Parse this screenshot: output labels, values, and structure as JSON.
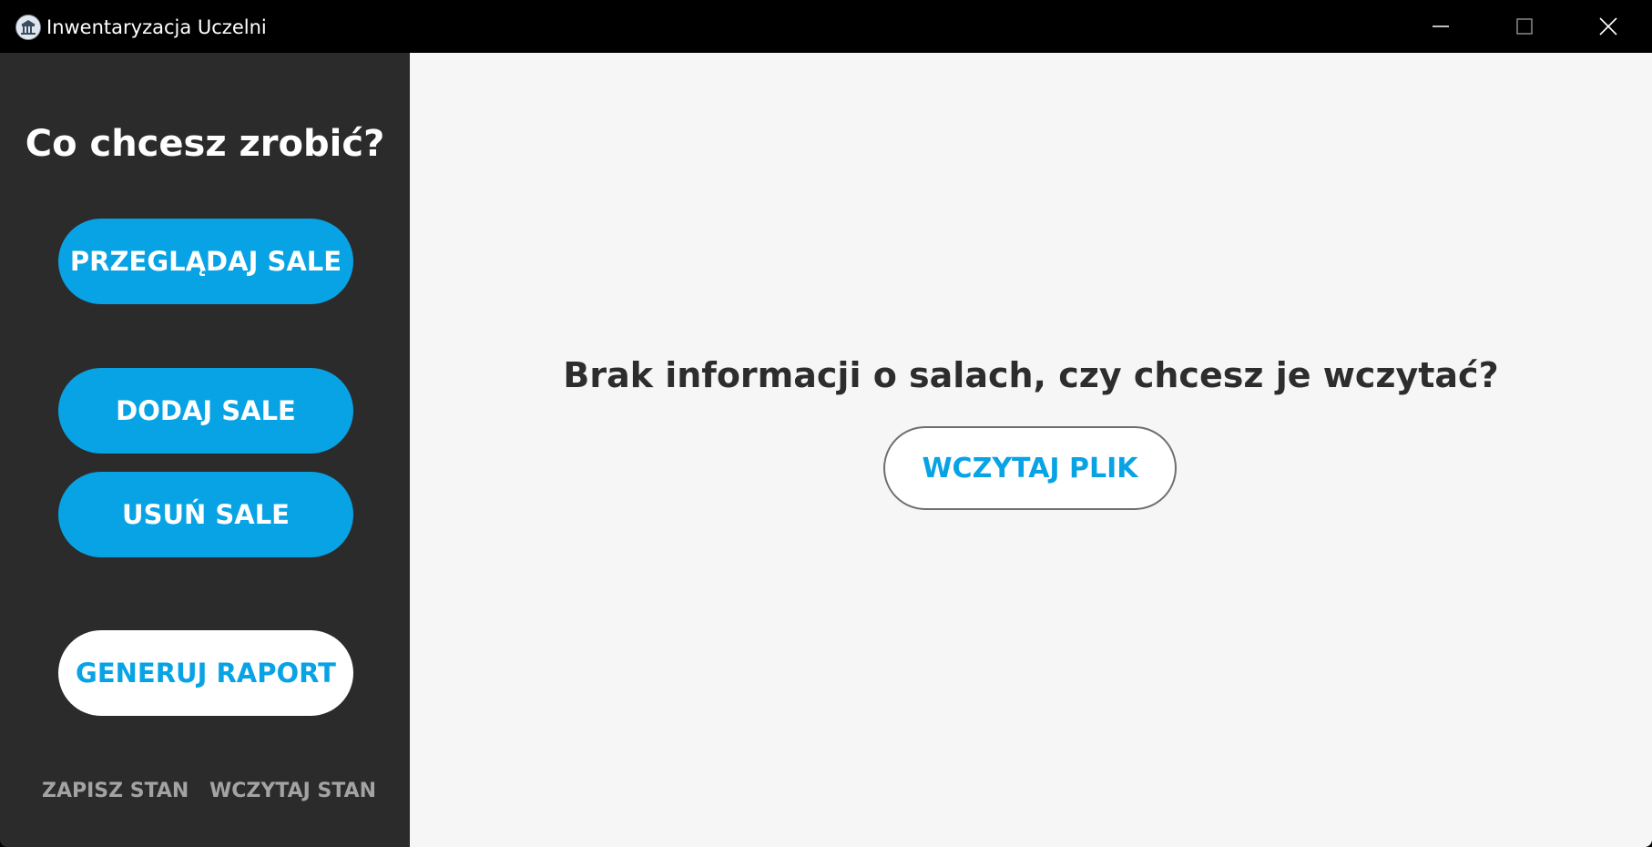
{
  "window": {
    "title": "Inwentaryzacja Uczelni",
    "app_icon": "university-building-icon",
    "controls": {
      "minimize_icon": "minimize-icon",
      "maximize_icon": "maximize-icon",
      "close_icon": "close-icon"
    }
  },
  "sidebar": {
    "heading": "Co chcesz zrobić?",
    "buttons": [
      {
        "label": "PRZEGLĄDAJ SALE"
      },
      {
        "label": "DODAJ SALE"
      },
      {
        "label": "USUŃ SALE"
      },
      {
        "label": "GENERUJ RAPORT"
      }
    ],
    "footer_links": {
      "save_state": "ZAPISZ STAN",
      "load_state": "WCZYTAJ STAN"
    }
  },
  "main": {
    "message": "Brak informacji o salach, czy chcesz je wczytać?",
    "load_file_label": "WCZYTAJ PLIK"
  },
  "colors": {
    "accent": "#08a3e4",
    "sidebar_bg": "#2b2b2b",
    "main_bg": "#f6f6f6",
    "titlebar_bg": "#000000",
    "link_text": "#a3a3a3"
  }
}
